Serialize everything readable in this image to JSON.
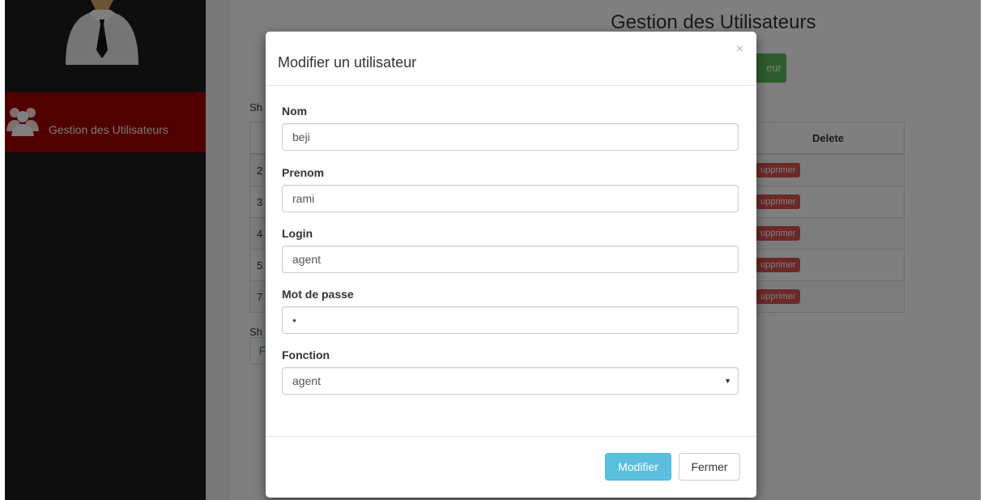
{
  "sidebar": {
    "items": [
      {
        "label": "Gestion des Utilisateurs",
        "icon": "users-icon"
      }
    ]
  },
  "page": {
    "title": "Gestion des Utilisateurs",
    "add_button_label": "eur",
    "show_entries_top": "Sh",
    "show_info_bottom": "Sh",
    "pagination_first": "F"
  },
  "table": {
    "delete_header": "Delete",
    "rows": [
      {
        "id": "2",
        "delete_label": "upprimer"
      },
      {
        "id": "3",
        "delete_label": "upprimer"
      },
      {
        "id": "4",
        "delete_label": "upprimer"
      },
      {
        "id": "5",
        "delete_label": "upprimer"
      },
      {
        "id": "7",
        "delete_label": "upprimer"
      }
    ]
  },
  "modal": {
    "title": "Modifier un utilisateur",
    "close_glyph": "×",
    "fields": {
      "nom": {
        "label": "Nom",
        "value": "beji"
      },
      "prenom": {
        "label": "Prenom",
        "value": "rami"
      },
      "login": {
        "label": "Login",
        "value": "agent"
      },
      "password": {
        "label": "Mot de passe",
        "value": "•"
      },
      "fonction": {
        "label": "Fonction",
        "value": "agent"
      }
    },
    "submit_label": "Modifier",
    "close_label": "Fermer"
  },
  "colors": {
    "sidebar_bg": "#1d1d1d",
    "active_item_bg": "#a20000",
    "primary_button": "#5bc0de",
    "delete_button": "#d9534f",
    "add_button": "#5cb85c"
  }
}
